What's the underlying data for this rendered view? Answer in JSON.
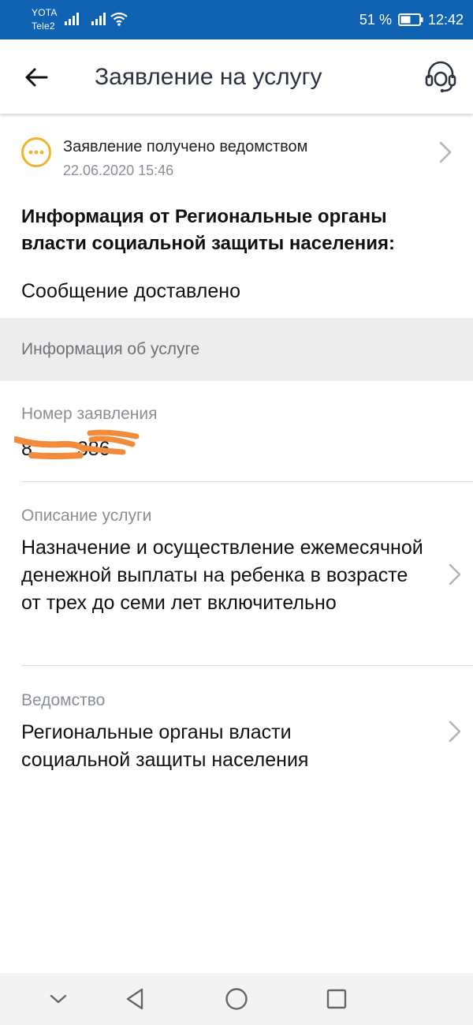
{
  "status_bar": {
    "carrier_1": "YOTA",
    "carrier_2": "Tele2",
    "battery_percent": "51 %",
    "time": "12:42"
  },
  "header": {
    "title": "Заявление на услугу",
    "back_icon": "arrow-left-icon",
    "support_icon": "headset-support-icon"
  },
  "status": {
    "title": "Заявление получено ведомством",
    "date": "22.06.2020 15:46",
    "icon": "more-dots-circle-icon",
    "icon_color": "#f0b429"
  },
  "info": {
    "heading": "Информация от Региональные органы власти социальной защиты населения:",
    "message": "Сообщение доставлено"
  },
  "section": {
    "label": "Информация об услуге"
  },
  "fields": {
    "number": {
      "label": "Номер заявления",
      "value": "8… …386",
      "redaction_color": "#f28b3c"
    },
    "description": {
      "label": "Описание услуги",
      "value": "Назначение и осуществление ежемесячной денежной выплаты на ребенка в возрасте от трех до семи лет включительно"
    },
    "agency": {
      "label": "Ведомство",
      "value": "Региональные органы власти социальной защиты населения"
    }
  },
  "nav_bar": {
    "icons": [
      "collapse-chevron-icon",
      "back-triangle-icon",
      "home-circle-icon",
      "recents-square-icon"
    ]
  },
  "colors": {
    "status_bar": "#0f63b2",
    "title": "#2b3340",
    "muted_text": "#8a8f96",
    "section_bg": "#ededed"
  }
}
